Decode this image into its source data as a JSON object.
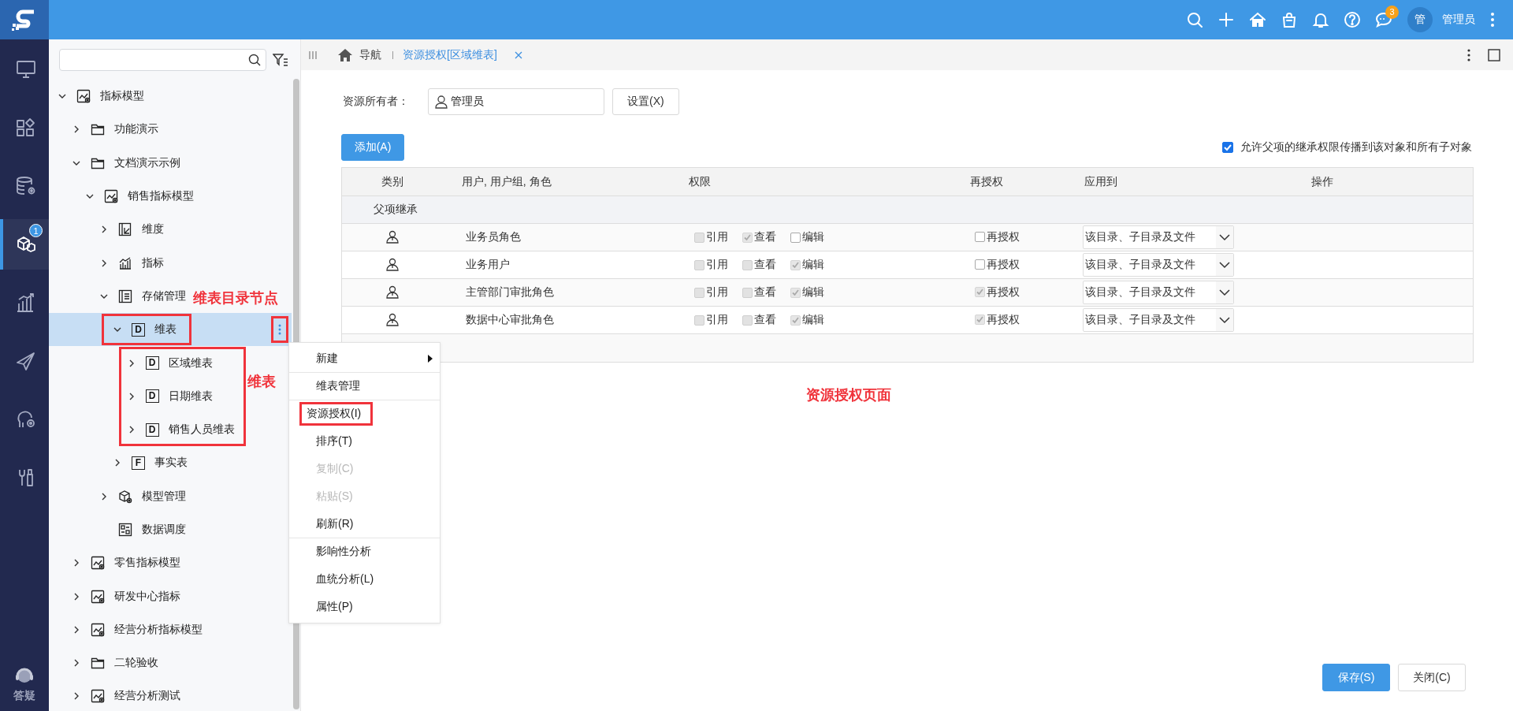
{
  "nav": {
    "items": [
      {
        "selected": false
      },
      {
        "selected": false
      },
      {
        "selected": false
      },
      {
        "selected": true,
        "badge": "1"
      },
      {
        "selected": false
      },
      {
        "selected": false
      },
      {
        "selected": false
      },
      {
        "selected": false
      }
    ],
    "help_label": "答疑"
  },
  "topbar": {
    "message_count": "3",
    "avatar": "管",
    "user_name": "管理员"
  },
  "tree": {
    "items": [
      {
        "label": "指标模型",
        "kind": "model",
        "expanded": true,
        "selected": false,
        "children": [
          {
            "label": "功能演示",
            "kind": "folder",
            "expanded": false,
            "selected": false
          },
          {
            "label": "文档演示示例",
            "kind": "folder",
            "expanded": true,
            "selected": false,
            "children": [
              {
                "label": "销售指标模型",
                "kind": "model",
                "expanded": true,
                "selected": false,
                "children": [
                  {
                    "label": "维度",
                    "kind": "dimension",
                    "expanded": false,
                    "selected": false
                  },
                  {
                    "label": "指标",
                    "kind": "metric",
                    "expanded": false,
                    "selected": false
                  },
                  {
                    "label": "存储管理",
                    "kind": "storage",
                    "expanded": true,
                    "selected": false,
                    "children": [
                      {
                        "label": "维表",
                        "kind": "table",
                        "icon_letter": "D",
                        "expanded": true,
                        "selected": true,
                        "outlined": true,
                        "more_outlined": true,
                        "note": "维表目录节点",
                        "children_outlined": true,
                        "children_note": "维表",
                        "children": [
                          {
                            "label": "区域维表",
                            "kind": "table",
                            "icon_letter": "D",
                            "expanded": false,
                            "selected": false
                          },
                          {
                            "label": "日期维表",
                            "kind": "table",
                            "icon_letter": "D",
                            "expanded": false,
                            "selected": false
                          },
                          {
                            "label": "销售人员维表",
                            "kind": "table",
                            "icon_letter": "D",
                            "expanded": false,
                            "selected": false
                          }
                        ]
                      },
                      {
                        "label": "事实表",
                        "kind": "table",
                        "icon_letter": "F",
                        "expanded": false,
                        "selected": false
                      }
                    ]
                  },
                  {
                    "label": "模型管理",
                    "kind": "model_admin",
                    "expanded": false,
                    "selected": false
                  },
                  {
                    "label": "数据调度",
                    "kind": "schedule",
                    "selected": false
                  }
                ]
              }
            ]
          },
          {
            "label": "零售指标模型",
            "kind": "model",
            "expanded": false,
            "selected": false
          },
          {
            "label": "研发中心指标",
            "kind": "model",
            "expanded": false,
            "selected": false
          },
          {
            "label": "经营分析指标模型",
            "kind": "model",
            "expanded": false,
            "selected": false
          },
          {
            "label": "二轮验收",
            "kind": "folder",
            "expanded": false,
            "selected": false
          },
          {
            "label": "经营分析测试",
            "kind": "model",
            "expanded": false,
            "selected": false
          }
        ]
      }
    ]
  },
  "context_menu": {
    "items": [
      {
        "label": "新建",
        "disabled": false,
        "submenu": true,
        "separator_before": false,
        "outlined": false
      },
      {
        "label": "维表管理",
        "disabled": false,
        "submenu": false,
        "separator_before": true,
        "outlined": false
      },
      {
        "label": "资源授权(I)",
        "disabled": false,
        "submenu": false,
        "separator_before": true,
        "outlined": true
      },
      {
        "label": "排序(T)",
        "disabled": false,
        "submenu": false,
        "separator_before": false,
        "outlined": false
      },
      {
        "label": "复制(C)",
        "disabled": true,
        "submenu": false,
        "separator_before": false,
        "outlined": false
      },
      {
        "label": "粘贴(S)",
        "disabled": true,
        "submenu": false,
        "separator_before": false,
        "outlined": false
      },
      {
        "label": "刷新(R)",
        "disabled": false,
        "submenu": false,
        "separator_before": false,
        "outlined": false
      },
      {
        "label": "影响性分析",
        "disabled": false,
        "submenu": false,
        "separator_before": true,
        "outlined": false
      },
      {
        "label": "血统分析(L)",
        "disabled": false,
        "submenu": false,
        "separator_before": false,
        "outlined": false
      },
      {
        "label": "属性(P)",
        "disabled": false,
        "submenu": false,
        "separator_before": false,
        "outlined": false
      }
    ]
  },
  "tab_bar": {
    "home_label": "导航",
    "tabs": [
      {
        "label": "资源授权[区域维表]",
        "selected": true
      }
    ]
  },
  "permissions": {
    "owner_label": "资源所有者：",
    "owner": "管理员",
    "set_button": "设置(X)",
    "add_button": "添加(A)",
    "inherit": {
      "label": "允许父项的继承权限传播到该对象和所有子对象",
      "checked": true
    },
    "columns": [
      "类别",
      "用户, 用户组, 角色",
      "权限",
      "再授权",
      "应用到",
      "操作"
    ],
    "group_label": "父项继承",
    "rows": [
      {
        "name": "业务员角色",
        "permissions": [
          {
            "label": "引用",
            "checked": false,
            "disabled": true
          },
          {
            "label": "查看",
            "checked": true,
            "disabled": true
          },
          {
            "label": "编辑",
            "checked": false,
            "disabled": false
          }
        ],
        "regrant": {
          "label": "再授权",
          "checked": false,
          "disabled": false
        },
        "apply_to": "该目录、子目录及文件"
      },
      {
        "name": "业务用户",
        "permissions": [
          {
            "label": "引用",
            "checked": false,
            "disabled": true
          },
          {
            "label": "查看",
            "checked": false,
            "disabled": true
          },
          {
            "label": "编辑",
            "checked": true,
            "disabled": true
          }
        ],
        "regrant": {
          "label": "再授权",
          "checked": false,
          "disabled": false
        },
        "apply_to": "该目录、子目录及文件"
      },
      {
        "name": "主管部门审批角色",
        "permissions": [
          {
            "label": "引用",
            "checked": false,
            "disabled": true
          },
          {
            "label": "查看",
            "checked": false,
            "disabled": true
          },
          {
            "label": "编辑",
            "checked": true,
            "disabled": true
          }
        ],
        "regrant": {
          "label": "再授权",
          "checked": true,
          "disabled": true
        },
        "apply_to": "该目录、子目录及文件"
      },
      {
        "name": "数据中心审批角色",
        "permissions": [
          {
            "label": "引用",
            "checked": false,
            "disabled": true
          },
          {
            "label": "查看",
            "checked": false,
            "disabled": true
          },
          {
            "label": "编辑",
            "checked": true,
            "disabled": true
          }
        ],
        "regrant": {
          "label": "再授权",
          "checked": true,
          "disabled": true
        },
        "apply_to": "该目录、子目录及文件"
      }
    ],
    "note": "资源授权页面",
    "save_button": "保存(S)",
    "close_button": "关闭(C)"
  }
}
